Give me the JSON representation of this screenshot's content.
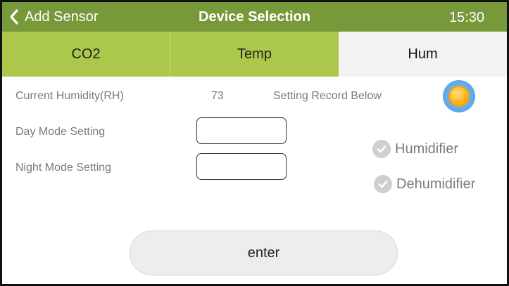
{
  "navbar": {
    "back_label": "Add Sensor",
    "title": "Device Selection",
    "time": "15:30"
  },
  "tabs": [
    {
      "label": "CO2",
      "selected": false
    },
    {
      "label": "Temp",
      "selected": false
    },
    {
      "label": "Hum",
      "selected": true
    }
  ],
  "humidity": {
    "current_label": "Current Humidity(RH)",
    "current_value": "73",
    "record_label": "Setting Record Below",
    "day_label": "Day Mode Setting",
    "day_value": "",
    "night_label": "Night Mode Setting",
    "night_value": ""
  },
  "options": {
    "humidifier": "Humidifier",
    "dehumidifier": "Dehumidifier"
  },
  "enter_label": "enter",
  "colors": {
    "navbar": "#77993a",
    "tab_inactive": "#abc84a",
    "tab_active": "#f2f2f2"
  },
  "icons": {
    "back": "chevron-left-icon",
    "weather": "sun-icon",
    "check": "checkmark-icon"
  }
}
